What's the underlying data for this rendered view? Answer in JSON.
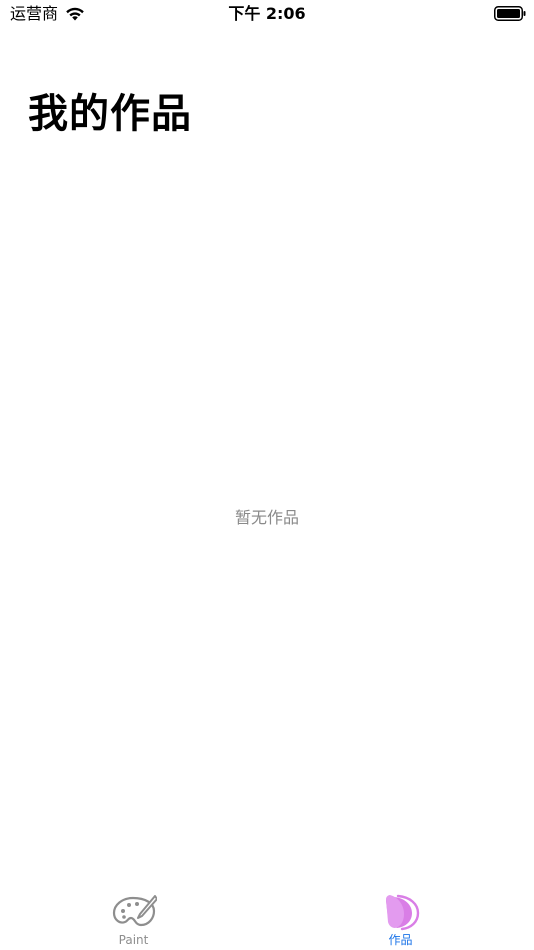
{
  "status_bar": {
    "carrier": "运营商",
    "time": "下午 2:06",
    "icons": [
      "wifi-icon",
      "battery-icon"
    ]
  },
  "header": {
    "title": "我的作品"
  },
  "main": {
    "empty_message": "暂无作品"
  },
  "tab_bar": {
    "selected": "works",
    "tabs": [
      {
        "id": "paint",
        "label": "Paint",
        "icon": "palette-icon",
        "color": "#8e8e8e"
      },
      {
        "id": "works",
        "label": "作品",
        "icon": "gallery-icon",
        "color": "#1a73e8",
        "icon_color": "#d97ee6"
      }
    ]
  },
  "colors": {
    "background": "#ffffff",
    "accent": "#1a73e8",
    "muted_text": "#8a8a8a"
  }
}
